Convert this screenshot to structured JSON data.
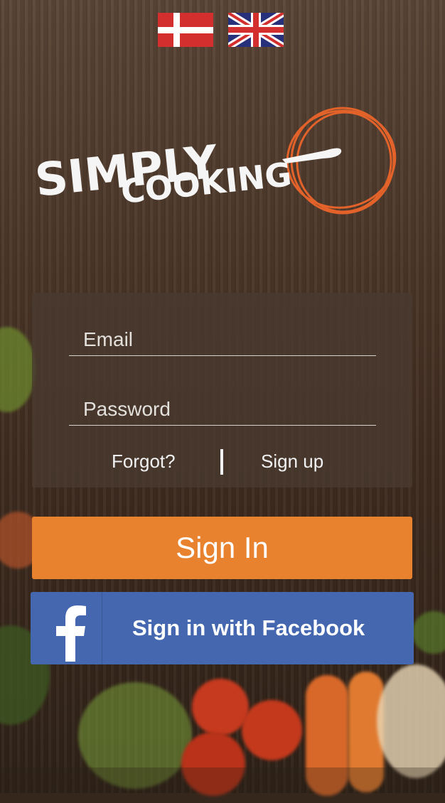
{
  "languages": [
    {
      "name": "Danish",
      "icon": "denmark-flag-icon",
      "colors": {
        "red": "#d32f2f",
        "white": "#ffffff"
      }
    },
    {
      "name": "English",
      "icon": "uk-flag-icon",
      "colors": {
        "blue": "#27307a",
        "red": "#d32f2f",
        "white": "#ffffff"
      }
    }
  ],
  "brand": {
    "logo_line1": "SIMPLY",
    "logo_line2": "COOKING",
    "accent_color": "#e9822f"
  },
  "login": {
    "email_placeholder": "Email",
    "password_placeholder": "Password",
    "forgot_label": "Forgot?",
    "signup_label": "Sign up",
    "signin_label": "Sign In",
    "facebook_label": "Sign in with Facebook",
    "facebook_color": "#4467b0"
  }
}
